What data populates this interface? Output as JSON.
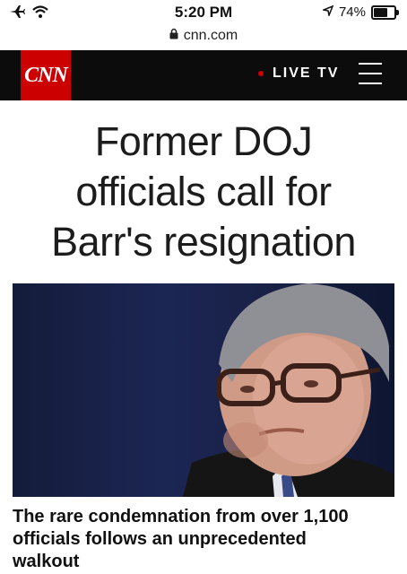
{
  "status_bar": {
    "time": "5:20 PM",
    "battery_percent": "74%",
    "battery_level": 0.74,
    "icons": [
      "airplane-icon",
      "wifi-icon",
      "location-icon",
      "battery-icon"
    ]
  },
  "browser": {
    "url": "cnn.com",
    "lock_icon": "lock-icon"
  },
  "header": {
    "logo_text": "CNN",
    "live_tv_label": "LIVE TV",
    "menu_icon": "hamburger-menu-icon",
    "colors": {
      "brand_red": "#cc0000",
      "header_bg": "#0c0c0c"
    }
  },
  "article": {
    "headline_lines": [
      "Former DOJ",
      "officials call for",
      "Barr's resignation"
    ],
    "caption_lines": [
      "The rare condemnation from over 1,100",
      "officials follows an unprecedented",
      "walkout"
    ]
  }
}
